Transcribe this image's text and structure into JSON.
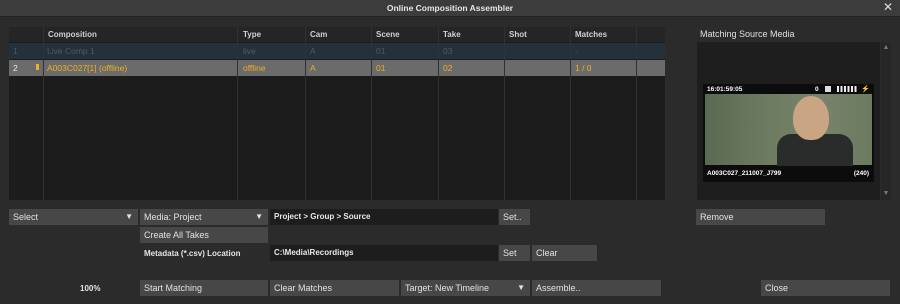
{
  "window": {
    "title": "Online Composition Assembler"
  },
  "table": {
    "columns": [
      "Composition",
      "Type",
      "Cam",
      "Scene",
      "Take",
      "Shot",
      "Matches"
    ],
    "rows": [
      {
        "num": "1",
        "composition": "Live Comp 1",
        "type": "live",
        "cam": "A",
        "scene": "01",
        "take": "03",
        "shot": "",
        "matches": "-"
      },
      {
        "num": "2",
        "composition": "A003C027[1] (offline)",
        "type": "offline",
        "cam": "A",
        "scene": "01",
        "take": "02",
        "shot": "",
        "matches": "1 / 0"
      }
    ]
  },
  "preview": {
    "title": "Matching Source Media",
    "timecode": "16:01:59:05",
    "channel": "0",
    "clip_name": "A003C027_211007_J799",
    "duration": "(240)"
  },
  "controls": {
    "select_label": "Select",
    "media_label": "Media: Project",
    "path_text": "Project > Group > Source",
    "set_button": "Set..",
    "create_all_takes": "Create All Takes",
    "metadata_label": "Metadata (*.csv) Location",
    "metadata_path": "C:\\Media\\Recordings",
    "set_button2": "Set",
    "clear_button": "Clear",
    "remove_button": "Remove",
    "zoom": "100%",
    "start_matching": "Start Matching",
    "clear_matches": "Clear Matches",
    "target_label": "Target: New Timeline",
    "assemble": "Assemble..",
    "close": "Close"
  },
  "colors": {
    "offline_text": "#f0b020",
    "selected_row": "#6b6b6b"
  },
  "icons": [
    "close-icon",
    "dropdown-arrow-icon",
    "scroll-up-icon",
    "scroll-down-icon",
    "speaker-icon",
    "audio-meter-icon",
    "flash-icon"
  ]
}
